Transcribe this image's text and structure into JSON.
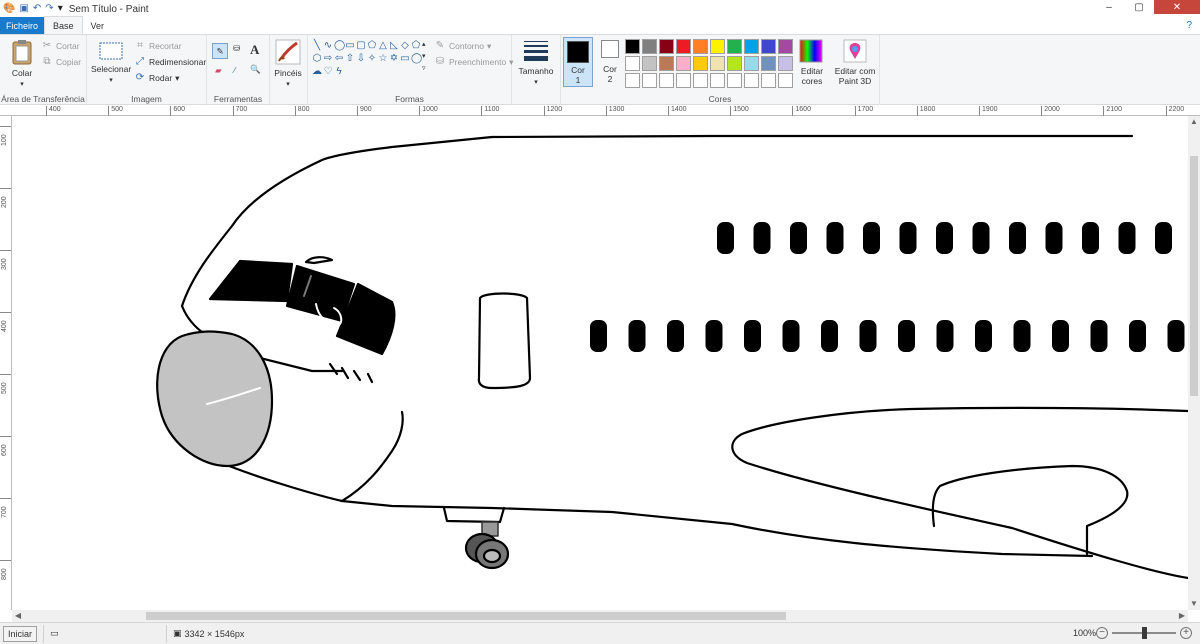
{
  "window": {
    "title": "Sem Título - Paint",
    "controls": {
      "minimize": "–",
      "maximize": "▢",
      "close": "✕"
    }
  },
  "quick_access": {
    "icons": [
      "paint-icon",
      "save-icon",
      "undo-icon",
      "redo-icon",
      "customize-icon"
    ]
  },
  "tabs": [
    {
      "label": "Ficheiro"
    },
    {
      "label": "Base"
    },
    {
      "label": "Ver"
    }
  ],
  "help_icon": "?",
  "clipboard": {
    "paste": "Colar",
    "cut": "Cortar",
    "copy": "Copiar",
    "group": "Área de Transferência"
  },
  "image": {
    "select": "Selecionar",
    "crop": "Recortar",
    "resize": "Redimensionar",
    "rotate": "Rodar",
    "group": "Imagem"
  },
  "tools": {
    "group": "Ferramentas",
    "brushes": "Pincéis"
  },
  "shapes": {
    "outline": "Contorno",
    "fill": "Preenchimento",
    "group": "Formas"
  },
  "size": {
    "label": "Tamanho"
  },
  "colors": {
    "color1_label": "Cor",
    "color1_num": "1",
    "color2_label": "Cor",
    "color2_num": "2",
    "edit": "Editar cores",
    "paint3d": "Editar com Paint 3D",
    "group": "Cores",
    "color1": "#000000",
    "color2": "#ffffff",
    "palette": [
      "#000000",
      "#7f7f7f",
      "#880015",
      "#ed1c24",
      "#ff7f27",
      "#fff200",
      "#22b14c",
      "#00a2e8",
      "#3f48cc",
      "#a349a4",
      "#ffffff",
      "#c3c3c3",
      "#b97a57",
      "#ffaec9",
      "#ffc90e",
      "#efe4b0",
      "#b5e61d",
      "#99d9ea",
      "#7092be",
      "#c8bfe7",
      "#ffffff",
      "#ffffff",
      "#ffffff",
      "#ffffff",
      "#ffffff",
      "#ffffff",
      "#ffffff",
      "#ffffff",
      "#ffffff",
      "#ffffff"
    ]
  },
  "ruler_h": [
    "400",
    "500",
    "600",
    "700",
    "800",
    "900",
    "1000",
    "1100",
    "1200",
    "1300",
    "1400",
    "1500",
    "1600",
    "1700",
    "1800",
    "1900",
    "2000",
    "2100",
    "2200"
  ],
  "ruler_v": [
    "100",
    "200",
    "300",
    "400",
    "500",
    "600",
    "700",
    "800"
  ],
  "status": {
    "start": "Iniciar",
    "dimensions": "3342 × 1546px",
    "zoom": "100%"
  }
}
